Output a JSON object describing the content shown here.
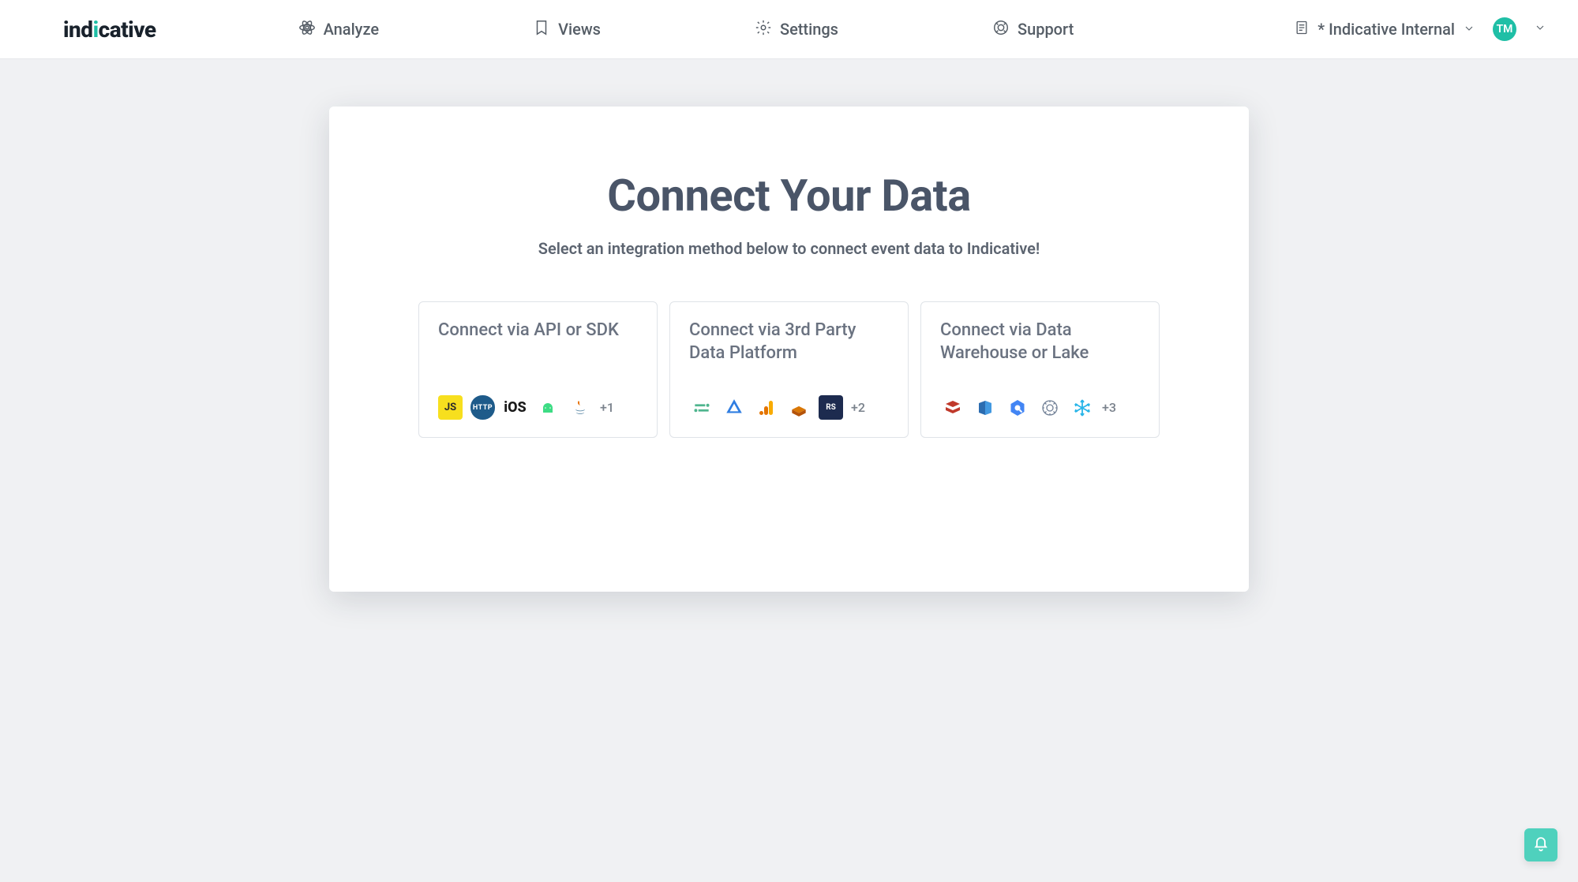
{
  "brand": {
    "name_prefix": "ind",
    "name_dot": "i",
    "name_suffix": "cative"
  },
  "nav": {
    "analyze": "Analyze",
    "views": "Views",
    "settings": "Settings",
    "support": "Support"
  },
  "project_picker": {
    "label": "* Indicative Internal"
  },
  "user": {
    "initials": "TM"
  },
  "main": {
    "title": "Connect Your Data",
    "subtitle": "Select an integration method below to connect event data to Indicative!"
  },
  "options": [
    {
      "title": "Connect via API or SDK",
      "icons": [
        "js",
        "http",
        "ios",
        "android",
        "java"
      ],
      "more": "+1"
    },
    {
      "title": "Connect via 3rd Party Data Platform",
      "icons": [
        "segment",
        "mparticle",
        "ga",
        "aws",
        "rudderstack"
      ],
      "more": "+2"
    },
    {
      "title": "Connect via Data Warehouse or Lake",
      "icons": [
        "databricks",
        "redshift",
        "bigquery",
        "athena",
        "snowflake"
      ],
      "more": "+3"
    }
  ],
  "icon_labels": {
    "js": "JS",
    "http": "HTTP",
    "ios": "iOS",
    "rudderstack": "RS"
  }
}
